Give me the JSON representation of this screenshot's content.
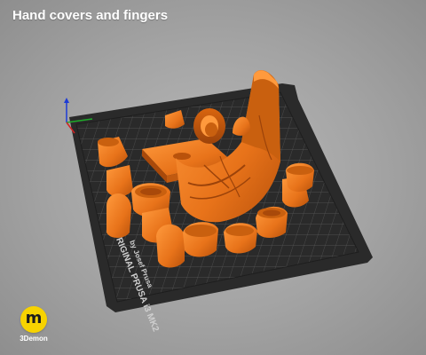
{
  "header": {
    "title": "Hand covers and fingers"
  },
  "bed": {
    "printer_label": "ORIGINAL PRUSA i3 MK2",
    "author_label": "by Josef Prusa"
  },
  "brand": {
    "logo_letter": "m",
    "name": "3Demon"
  },
  "colors": {
    "background": "#a3a3a3",
    "bed": "#2c2c2c",
    "grid": "#5a5a5a",
    "model": "#e8731a",
    "logo": "#f7d300"
  }
}
